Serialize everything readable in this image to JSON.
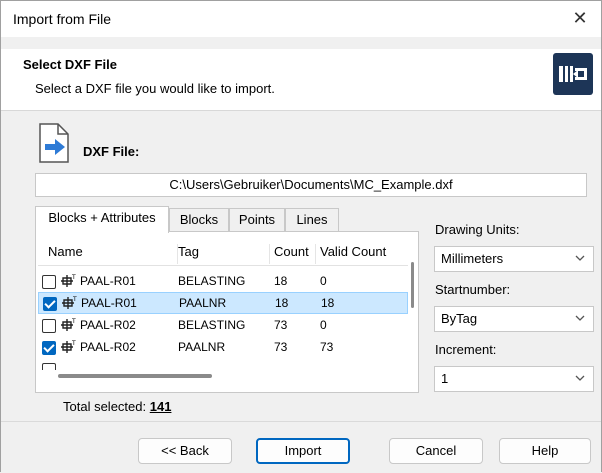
{
  "window": {
    "title": "Import from File",
    "close_glyph": "✕"
  },
  "header": {
    "title": "Select DXF File",
    "subtitle": "Select a DXF file you would like to import.",
    "logo_icon": "import-logo-icon"
  },
  "file": {
    "label": "DXF File:",
    "path": "C:\\Users\\Gebruiker\\Documents\\MC_Example.dxf",
    "icon": "dxf-file-import-icon"
  },
  "tabs": [
    "Blocks + Attributes",
    "Blocks",
    "Points",
    "Lines"
  ],
  "table": {
    "columns": [
      "Name",
      "Tag",
      "Count",
      "Valid Count"
    ],
    "rows": [
      {
        "checked": false,
        "name": "PAAL-R01",
        "tag": "BELASTING",
        "count": "18",
        "valid": "0"
      },
      {
        "checked": true,
        "name": "PAAL-R01",
        "tag": "PAALNR",
        "count": "18",
        "valid": "18"
      },
      {
        "checked": false,
        "name": "PAAL-R02",
        "tag": "BELASTING",
        "count": "73",
        "valid": "0"
      },
      {
        "checked": true,
        "name": "PAAL-R02",
        "tag": "PAALNR",
        "count": "73",
        "valid": "73"
      }
    ]
  },
  "total": {
    "label": "Total selected:",
    "value": "141"
  },
  "options": {
    "units_label": "Drawing Units:",
    "units_value": "Millimeters",
    "start_label": "Startnumber:",
    "start_value": "ByTag",
    "increment_label": "Increment:",
    "increment_value": "1"
  },
  "buttons": {
    "back": "<< Back",
    "import": "Import",
    "cancel": "Cancel",
    "help": "Help"
  },
  "colors": {
    "accent": "#0067c0",
    "selection": "#cce8ff",
    "logo": "#1d3557"
  }
}
